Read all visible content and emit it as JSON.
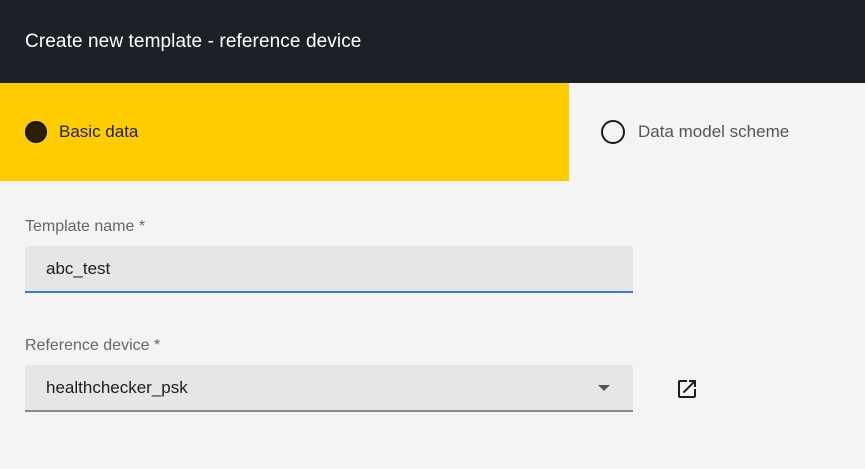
{
  "header": {
    "title": "Create new template - reference device"
  },
  "steps": [
    {
      "label": "Basic data",
      "active": true
    },
    {
      "label": "Data model scheme",
      "active": false
    }
  ],
  "form": {
    "template_name": {
      "label": "Template name *",
      "value": "abc_test"
    },
    "reference_device": {
      "label": "Reference device *",
      "value": "healthchecker_psk",
      "icon": "chevron-down-icon"
    }
  },
  "actions": {
    "open_device_icon": "open-in-new-icon"
  },
  "colors": {
    "header_bg": "#1d2026",
    "active_step_bg": "#ffcc00",
    "page_bg": "#f4f4f4",
    "focus_underline": "#3d7bd6"
  }
}
